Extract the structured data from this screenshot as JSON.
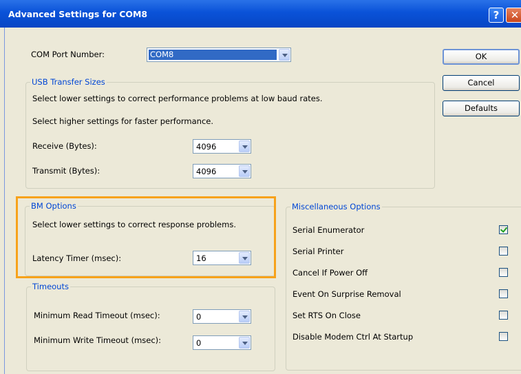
{
  "window": {
    "title": "Advanced Settings for COM8"
  },
  "com_port": {
    "label": "COM Port Number:",
    "value": "COM8"
  },
  "usb": {
    "legend": "USB Transfer Sizes",
    "line1": "Select lower settings to correct performance problems at low baud rates.",
    "line2": "Select higher settings for faster performance.",
    "receive_label": "Receive (Bytes):",
    "receive_value": "4096",
    "transmit_label": "Transmit (Bytes):",
    "transmit_value": "4096"
  },
  "bm": {
    "legend": "BM Options",
    "line1": "Select lower settings to correct response problems.",
    "latency_label": "Latency Timer (msec):",
    "latency_value": "16"
  },
  "timeouts": {
    "legend": "Timeouts",
    "read_label": "Minimum Read Timeout (msec):",
    "read_value": "0",
    "write_label": "Minimum Write Timeout (msec):",
    "write_value": "0"
  },
  "buttons": {
    "ok": "OK",
    "cancel": "Cancel",
    "defaults": "Defaults"
  },
  "misc": {
    "legend": "Miscellaneous Options",
    "items": [
      {
        "label": "Serial Enumerator",
        "checked": true
      },
      {
        "label": "Serial Printer",
        "checked": false
      },
      {
        "label": "Cancel If Power Off",
        "checked": false
      },
      {
        "label": "Event On Surprise Removal",
        "checked": false
      },
      {
        "label": "Set RTS On Close",
        "checked": false
      },
      {
        "label": "Disable Modem Ctrl At Startup",
        "checked": false
      }
    ]
  },
  "colors": {
    "highlight": "#f7a21b",
    "titlebar": "#0a52d8",
    "legend": "#0046d5"
  }
}
